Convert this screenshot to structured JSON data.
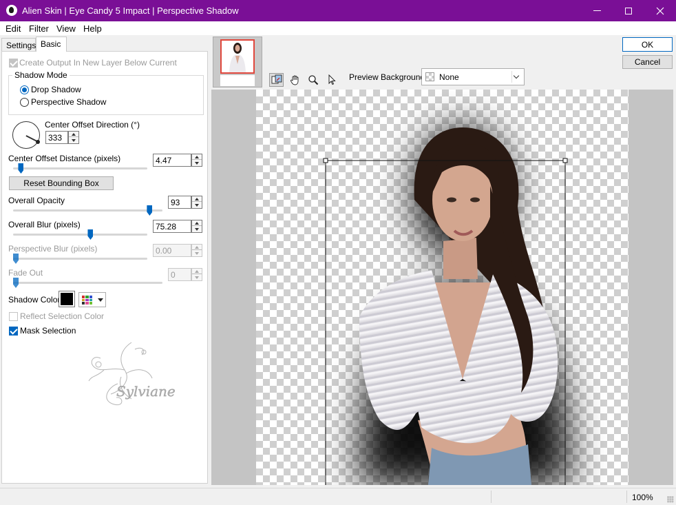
{
  "window": {
    "title": "Alien Skin | Eye Candy 5 Impact | Perspective Shadow"
  },
  "menu": {
    "edit": "Edit",
    "filter": "Filter",
    "view": "View",
    "help": "Help"
  },
  "tabs": {
    "settings": "Settings",
    "basic": "Basic"
  },
  "panel": {
    "create_output": {
      "label": "Create Output In New Layer Below Current",
      "checked": true,
      "enabled": false
    },
    "shadow_mode": {
      "title": "Shadow Mode",
      "options": [
        "Drop Shadow",
        "Perspective Shadow"
      ],
      "selected": "Drop Shadow"
    },
    "center_offset_direction": {
      "label": "Center Offset Direction (°)",
      "value": "333"
    },
    "center_offset_distance": {
      "label": "Center Offset Distance (pixels)",
      "value": "4.47",
      "slider_fraction": 0.04
    },
    "reset_bounding_box": "Reset Bounding Box",
    "overall_opacity": {
      "label": "Overall Opacity",
      "value": "93",
      "slider_fraction": 0.93
    },
    "overall_blur": {
      "label": "Overall Blur (pixels)",
      "value": "75.28",
      "slider_fraction": 0.58
    },
    "perspective_blur": {
      "label": "Perspective Blur (pixels)",
      "value": "0.00",
      "slider_fraction": 0.0,
      "enabled": false
    },
    "fade_out": {
      "label": "Fade Out",
      "value": "0",
      "slider_fraction": 0.0,
      "enabled": false
    },
    "shadow_color": {
      "label": "Shadow Color",
      "color": "#000000"
    },
    "reflect_selection_color": {
      "label": "Reflect Selection Color",
      "checked": false,
      "enabled": false
    },
    "mask_selection": {
      "label": "Mask Selection",
      "checked": true
    },
    "watermark_text": "Sylviane"
  },
  "preview": {
    "background_label": "Preview Background:",
    "background_value": "None",
    "tools": [
      "navigate-preview-icon",
      "hand-pan-icon",
      "zoom-magnifier-icon",
      "arrow-pointer-icon"
    ]
  },
  "buttons": {
    "ok": "OK",
    "cancel": "Cancel"
  },
  "status": {
    "zoom": "100%"
  },
  "colors": {
    "titlebar": "#7a0f96",
    "accent": "#0067c0",
    "preview_gray": "#c4c4c4"
  }
}
